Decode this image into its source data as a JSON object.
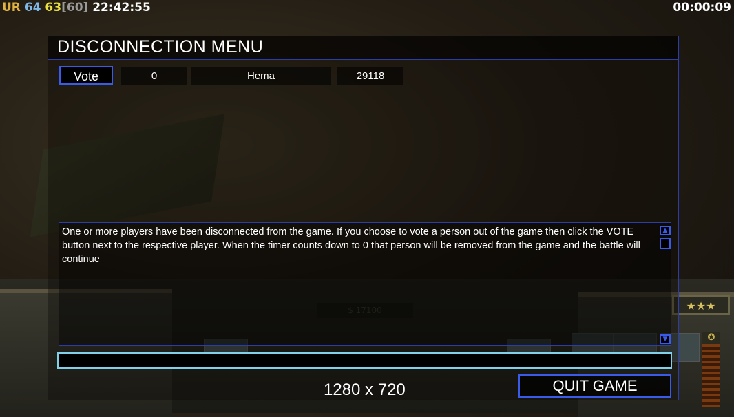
{
  "hud": {
    "faction_tag": "UR",
    "stat_a": "64",
    "stat_b": "63",
    "stat_c": "[60]",
    "clock": "22:42:55",
    "timer": "00:00:09",
    "money": "$ 17100",
    "rank_stars": "★★★",
    "rank_badge_icon": "star-badge-icon"
  },
  "dialog": {
    "title": "DISCONNECTION MENU",
    "players": [
      {
        "vote_label": "Vote",
        "count": "0",
        "name": "Hema",
        "ping": "29118"
      }
    ],
    "message": "One or more players have been disconnected from the game. If you choose to vote a person out of the game then click the VOTE button next to the respective player. When the timer counts down to 0 that person will be removed from the game and the battle will continue",
    "chat_input_value": "",
    "resolution": "1280 x 720",
    "quit_label": "QUIT GAME"
  },
  "colors": {
    "border_accent": "#2b3ea8",
    "button_border": "#3a5ae8",
    "input_border": "#7fd0e8",
    "faction_tag": "#e0b040",
    "stat_blue": "#7fb8e8",
    "stat_yellow": "#e8e040"
  }
}
